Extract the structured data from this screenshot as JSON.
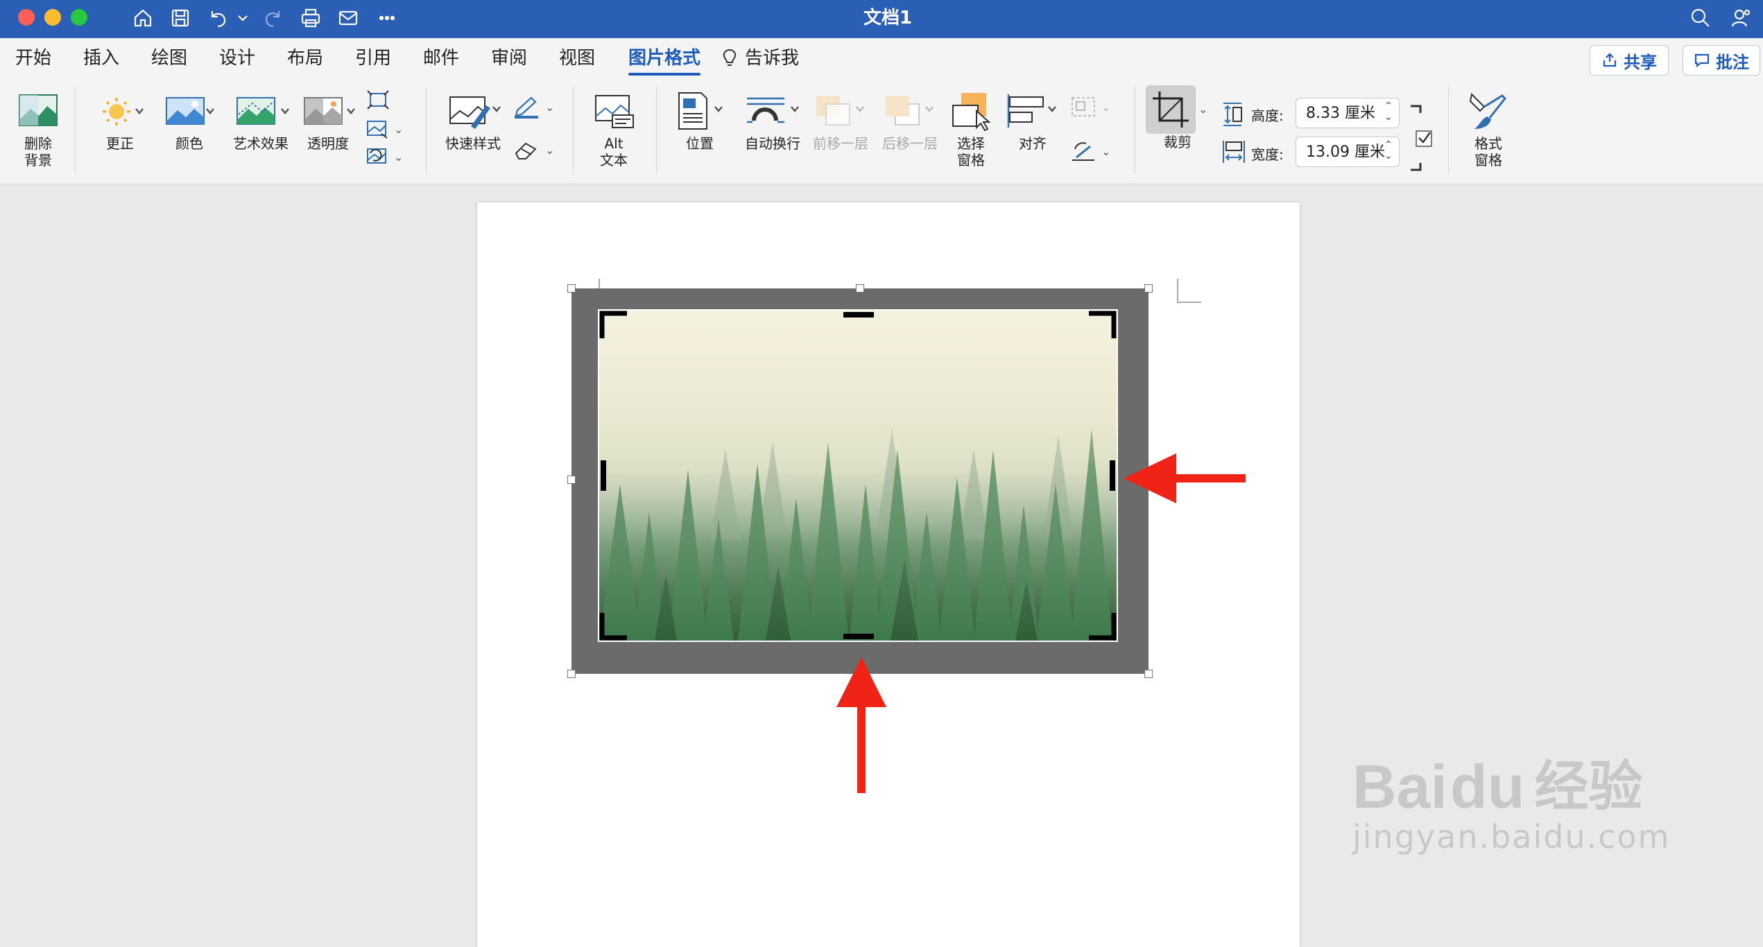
{
  "window": {
    "title": "文档1",
    "accent_color": "#2b5fb5"
  },
  "titlebar_icons": [
    "home-icon",
    "save-icon",
    "undo-icon",
    "dropdown-icon",
    "redo-icon",
    "print-icon",
    "mail-icon",
    "more-icon"
  ],
  "menu_tabs": [
    {
      "label": "开始",
      "active": false
    },
    {
      "label": "插入",
      "active": false
    },
    {
      "label": "绘图",
      "active": false
    },
    {
      "label": "设计",
      "active": false
    },
    {
      "label": "布局",
      "active": false
    },
    {
      "label": "引用",
      "active": false
    },
    {
      "label": "邮件",
      "active": false
    },
    {
      "label": "审阅",
      "active": false
    },
    {
      "label": "视图",
      "active": false
    },
    {
      "label": "图片格式",
      "active": true
    },
    {
      "label": "告诉我",
      "active": false
    }
  ],
  "share_label": "共享",
  "comment_label": "批注",
  "ribbon": {
    "remove_bg": "删除\n背景",
    "corrections": "更正",
    "color": "颜色",
    "artistic": "艺术效果",
    "transparency": "透明度",
    "quick_styles": "快速样式",
    "alt_text_line1": "Alt",
    "alt_text_line2": "文本",
    "position": "位置",
    "wrap_text": "自动换行",
    "bring_forward": "前移一层",
    "send_backward": "后移一层",
    "selection_pane_line1": "选择",
    "selection_pane_line2": "窗格",
    "align": "对齐",
    "crop": "裁剪",
    "height_label": "高度:",
    "height_value": "8.33 厘米",
    "width_label": "宽度:",
    "width_value": "13.09 厘米",
    "format_pane_line1": "格式",
    "format_pane_line2": "窗格"
  },
  "watermark": {
    "brand": "Bai",
    "paw": "du",
    "cn": "经验",
    "url": "jingyan.baidu.com"
  }
}
